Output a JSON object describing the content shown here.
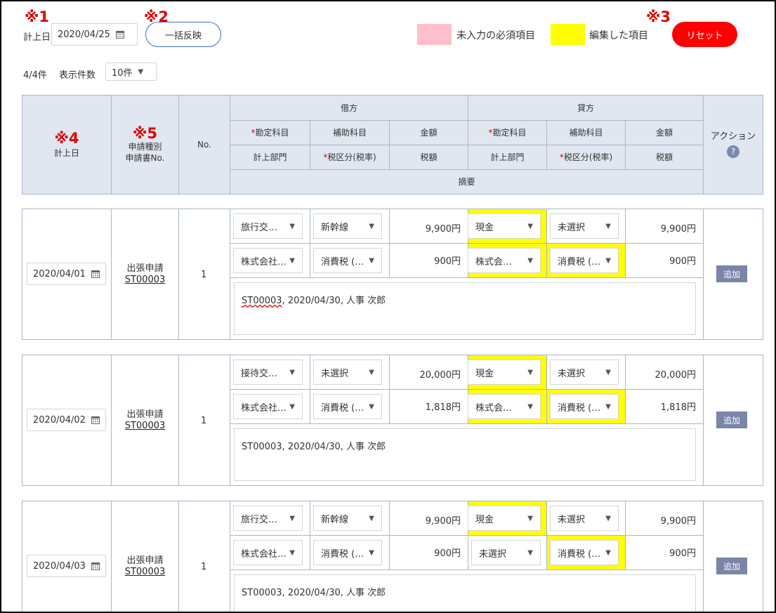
{
  "notes": {
    "n1": "※1",
    "n2": "※2",
    "n3": "※3",
    "n4": "※4",
    "n5": "※5"
  },
  "toolbar": {
    "date_label": "計上日",
    "date_value": "2020/04/25",
    "apply_all_label": "一括反映",
    "legend_required": "未入力の必須項目",
    "legend_edited": "編集した項目",
    "reset_label": "リセット",
    "count_text": "4/4件",
    "page_size_label": "表示件数",
    "page_size_value": "10件"
  },
  "colors": {
    "required": "#ffc0cb",
    "edited": "#ffff00",
    "reset": "#ff0000"
  },
  "header": {
    "date": "計上日",
    "app_type": "申請種別",
    "app_no": "申請書No.",
    "no": "No.",
    "debit": "借方",
    "credit": "貸方",
    "account": "勘定科目",
    "sub_account": "補助科目",
    "amount": "金額",
    "department": "計上部門",
    "tax_class": "税区分(税率)",
    "tax_amount": "税額",
    "memo": "摘要",
    "action": "アクション",
    "help": "?"
  },
  "rows": [
    {
      "date": "2020/04/01",
      "app_type": "出張申請",
      "app_no": "ST00003",
      "no": "1",
      "debit_account": "旅行交…",
      "debit_sub": "新幹線",
      "debit_amount": "9,900円",
      "debit_dept": "株式会社…",
      "debit_tax": "消費税 (…",
      "debit_tax_amount": "900円",
      "credit_account": "現金",
      "credit_sub": "未選択",
      "credit_amount": "9,900円",
      "credit_dept": "株式会…",
      "credit_tax": "消費税 (…",
      "credit_tax_amount": "900円",
      "memo_code": "ST00003",
      "memo_rest": ", 2020/04/30, 人事 次郎",
      "add": "追加"
    },
    {
      "date": "2020/04/02",
      "app_type": "出張申請",
      "app_no": "ST00003",
      "no": "1",
      "debit_account": "接待交…",
      "debit_sub": "未選択",
      "debit_amount": "20,000円",
      "debit_dept": "株式会社…",
      "debit_tax": "消費税 (…",
      "debit_tax_amount": "1,818円",
      "credit_account": "現金",
      "credit_sub": "未選択",
      "credit_amount": "20,000円",
      "credit_dept": "株式会…",
      "credit_tax": "消費税 (…",
      "credit_tax_amount": "1,818円",
      "memo": "ST00003, 2020/04/30, 人事 次郎",
      "add": "追加"
    },
    {
      "date": "2020/04/03",
      "app_type": "出張申請",
      "app_no": "ST00003",
      "no": "1",
      "debit_account": "旅行交…",
      "debit_sub": "新幹線",
      "debit_amount": "9,900円",
      "debit_dept": "株式会社…",
      "debit_tax": "消費税 (…",
      "debit_tax_amount": "900円",
      "credit_account": "現金",
      "credit_sub": "未選択",
      "credit_amount": "9,900円",
      "credit_dept": "未選択",
      "credit_tax": "消費税 (…",
      "credit_tax_amount": "900円",
      "memo": "ST00003, 2020/04/30, 人事 次郎",
      "add": "追加"
    }
  ]
}
